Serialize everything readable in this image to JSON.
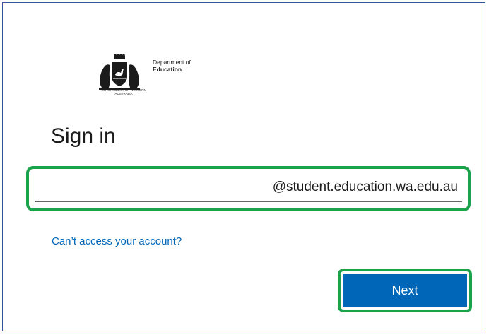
{
  "logo": {
    "line1": "Department of",
    "line2": "Education",
    "seal_caption": "GOVERNMENT OF WESTERN AUSTRALIA"
  },
  "title": "Sign in",
  "email": {
    "value": "@student.education.wa.edu.au"
  },
  "cant_access_link": "Can’t access your account?",
  "next_button": "Next",
  "colors": {
    "accent": "#0067b8",
    "highlight": "#1aa34a",
    "frame_border": "#2f5597"
  }
}
